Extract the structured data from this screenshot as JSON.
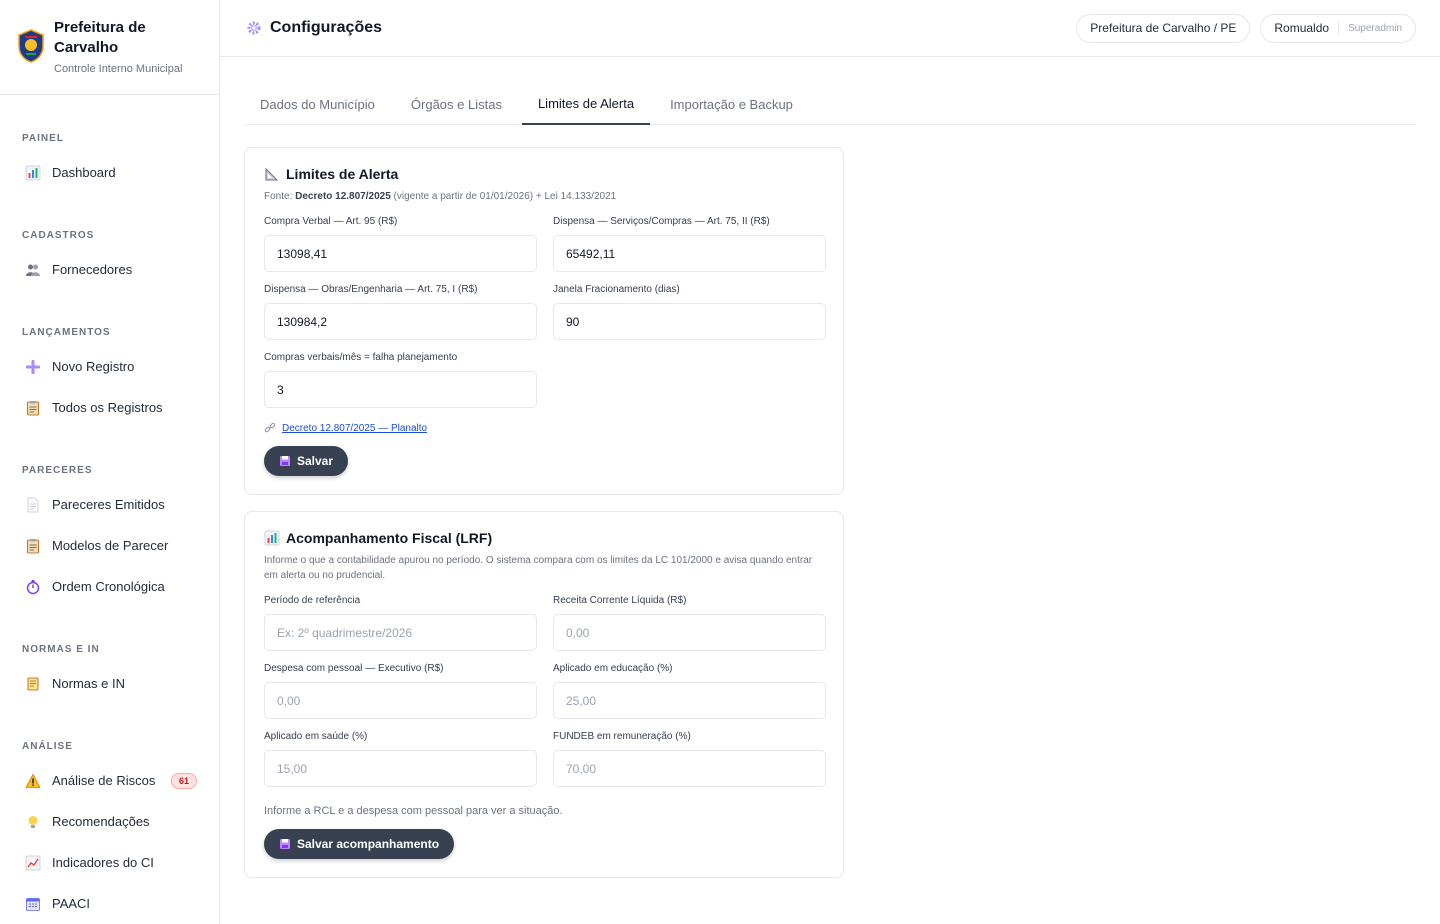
{
  "brand": {
    "name": "Prefeitura de Carvalho",
    "subtitle": "Controle Interno Municipal"
  },
  "sidebar": {
    "sections": [
      {
        "title": "PAINEL",
        "items": [
          {
            "label": "Dashboard",
            "icon": "bar-chart-icon"
          }
        ]
      },
      {
        "title": "CADASTROS",
        "items": [
          {
            "label": "Fornecedores",
            "icon": "people-icon"
          }
        ]
      },
      {
        "title": "LANÇAMENTOS",
        "items": [
          {
            "label": "Novo Registro",
            "icon": "plus-icon"
          },
          {
            "label": "Todos os Registros",
            "icon": "clipboard-icon"
          }
        ]
      },
      {
        "title": "PARECERES",
        "items": [
          {
            "label": "Pareceres Emitidos",
            "icon": "document-icon"
          },
          {
            "label": "Modelos de Parecer",
            "icon": "clipboard-icon"
          },
          {
            "label": "Ordem Cronológica",
            "icon": "stopwatch-icon"
          }
        ]
      },
      {
        "title": "NORMAS E IN",
        "items": [
          {
            "label": "Normas e IN",
            "icon": "scroll-icon"
          }
        ]
      },
      {
        "title": "ANÁLISE",
        "items": [
          {
            "label": "Análise de Riscos",
            "icon": "warning-icon",
            "badge": "61"
          },
          {
            "label": "Recomendações",
            "icon": "lightbulb-icon"
          },
          {
            "label": "Indicadores do CI",
            "icon": "line-chart-icon"
          },
          {
            "label": "PAACI",
            "icon": "calendar-icon"
          }
        ]
      }
    ]
  },
  "header": {
    "title": "Configurações",
    "municipality": "Prefeitura de Carvalho / PE",
    "user_name": "Romualdo",
    "user_role": "Superadmin"
  },
  "tabs": [
    {
      "label": "Dados do Município",
      "active": false
    },
    {
      "label": "Órgãos e Listas",
      "active": false
    },
    {
      "label": "Limites de Alerta",
      "active": true
    },
    {
      "label": "Importação e Backup",
      "active": false
    }
  ],
  "limits_card": {
    "title": "Limites de Alerta",
    "source_prefix": "Fonte: ",
    "source_bold": "Decreto 12.807/2025",
    "source_suffix": " (vigente a partir de 01/01/2026) + Lei 14.133/2021",
    "fields": [
      {
        "label": "Compra Verbal — Art. 95 (R$)",
        "value": "13098,41"
      },
      {
        "label": "Dispensa — Serviços/Compras — Art. 75, II (R$)",
        "value": "65492,11"
      },
      {
        "label": "Dispensa — Obras/Engenharia — Art. 75, I (R$)",
        "value": "130984,2"
      },
      {
        "label": "Janela Fracionamento (dias)",
        "value": "90"
      },
      {
        "label": "Compras verbais/mês = falha planejamento",
        "value": "3"
      }
    ],
    "link_text": "Decreto 12.807/2025 — Planalto",
    "save_label": "Salvar"
  },
  "fiscal_card": {
    "title": "Acompanhamento Fiscal (LRF)",
    "description": "Informe o que a contabilidade apurou no período. O sistema compara com os limites da LC 101/2000 e avisa quando entrar em alerta ou no prudencial.",
    "fields": [
      {
        "label": "Período de referência",
        "placeholder": "Ex: 2º quadrimestre/2026"
      },
      {
        "label": "Receita Corrente Líquida (R$)",
        "placeholder": "0,00"
      },
      {
        "label": "Despesa com pessoal — Executivo (R$)",
        "placeholder": "0,00"
      },
      {
        "label": "Aplicado em educação (%)",
        "placeholder": "25,00"
      },
      {
        "label": "Aplicado em saúde (%)",
        "placeholder": "15,00"
      },
      {
        "label": "FUNDEB em remuneração (%)",
        "placeholder": "70,00"
      }
    ],
    "hint": "Informe a RCL e a despesa com pessoal para ver a situação.",
    "save_label": "Salvar acompanhamento"
  },
  "colors": {
    "accent": "#374151",
    "link": "#1d4ed8",
    "badge_bg": "#fee2e2",
    "badge_text": "#b91c1c"
  }
}
